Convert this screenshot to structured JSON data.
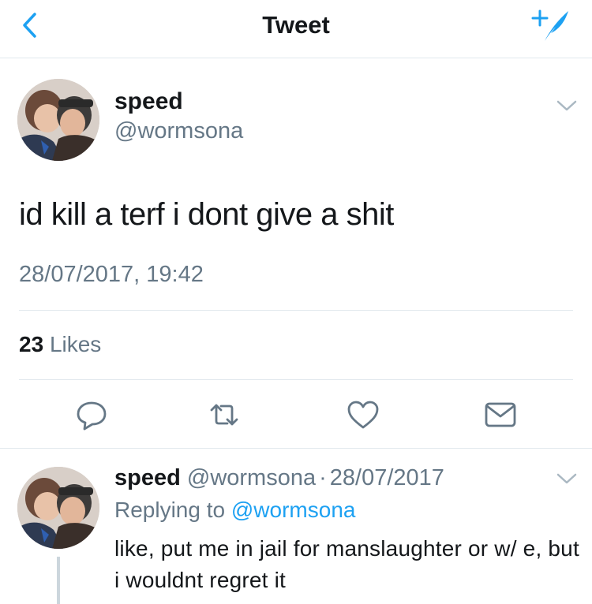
{
  "nav": {
    "title": "Tweet",
    "back_icon": "chevron-left-icon",
    "compose_icon": "compose-tweet-icon",
    "accent_color": "#1da1f2"
  },
  "tweet": {
    "author_name": "speed",
    "author_handle": "@wormsona",
    "text": "id kill a terf i dont give a shit",
    "timestamp": "28/07/2017, 19:42",
    "likes_count": "23",
    "likes_label": "Likes",
    "actions": [
      "reply-icon",
      "retweet-icon",
      "like-icon",
      "direct-message-icon"
    ]
  },
  "reply": {
    "author_name": "speed",
    "author_handle": "@wormsona",
    "separator": "·",
    "date": "28/07/2017",
    "replying_prefix": "Replying to",
    "replying_to": "@wormsona",
    "text": "like, put me in jail for manslaughter or w/ e, but i wouldnt regret it"
  },
  "colors": {
    "text_primary": "#14171a",
    "text_secondary": "#657786",
    "divider": "#e1e8ed",
    "icon_gray": "#657786"
  }
}
